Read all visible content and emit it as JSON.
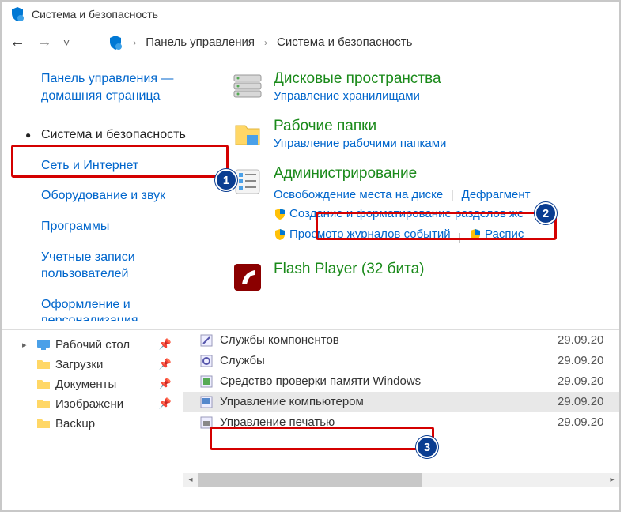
{
  "titlebar": {
    "title": "Система и безопасность"
  },
  "breadcrumb": {
    "root": "Панель управления",
    "current": "Система и безопасность"
  },
  "leftnav": {
    "home": "Панель управления — домашняя страница",
    "items": [
      {
        "label": "Система и безопасность",
        "active": true
      },
      {
        "label": "Сеть и Интернет"
      },
      {
        "label": "Оборудование и звук"
      },
      {
        "label": "Программы"
      },
      {
        "label": "Учетные записи пользователей"
      },
      {
        "label": "Оформление и персонализация"
      }
    ]
  },
  "categories": {
    "storage": {
      "title": "Дисковые пространства",
      "sub": "Управление хранилищами"
    },
    "workfolders": {
      "title": "Рабочие папки",
      "sub": "Управление рабочими папками"
    },
    "admin": {
      "title": "Администрирование",
      "subs": {
        "a": "Освобождение места на диске",
        "b": "Дефрагмент",
        "c": "Создание и форматирование разделов же",
        "d": "Просмотр журналов событий",
        "e": "Распис"
      }
    },
    "flash": {
      "title": "Flash Player (32 бита)"
    }
  },
  "tree": [
    {
      "label": "Рабочий стол",
      "icon": "desktop",
      "pinned": true,
      "expandable": true
    },
    {
      "label": "Загрузки",
      "icon": "folder",
      "pinned": true
    },
    {
      "label": "Документы",
      "icon": "folder",
      "pinned": true
    },
    {
      "label": "Изображени",
      "icon": "folder",
      "pinned": true
    },
    {
      "label": "Backup",
      "icon": "folder"
    }
  ],
  "files": [
    {
      "name": "Службы компонентов",
      "date": "29.09.20"
    },
    {
      "name": "Службы",
      "date": "29.09.20"
    },
    {
      "name": "Средство проверки памяти Windows",
      "date": "29.09.20"
    },
    {
      "name": "Управление компьютером",
      "date": "29.09.20",
      "selected": true
    },
    {
      "name": "Управление печатью",
      "date": "29.09.20"
    }
  ],
  "badges": {
    "b1": "1",
    "b2": "2",
    "b3": "3"
  }
}
